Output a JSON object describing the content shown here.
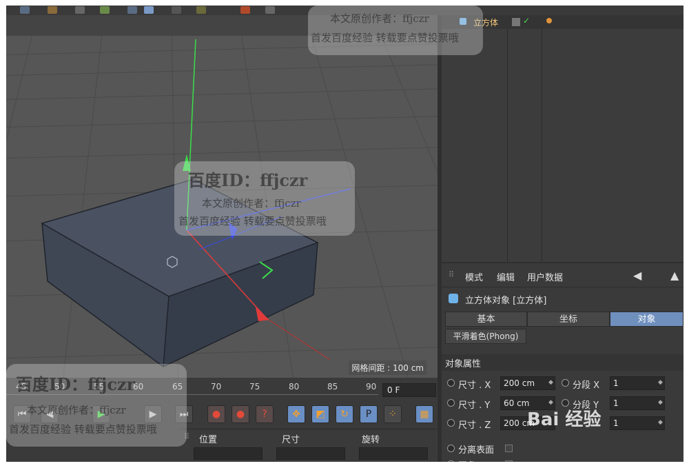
{
  "viewport": {
    "grid_spacing": "网格间距 : 100 cm"
  },
  "object_manager": {
    "object_name": "立方体"
  },
  "attributes": {
    "menu": [
      "模式",
      "编辑",
      "用户数据"
    ],
    "object_title": "立方体对象 [立方体]",
    "tabs": [
      "基本",
      "坐标",
      "对象"
    ],
    "active_tab": "对象",
    "phong_tab": "平滑着色(Phong)",
    "section_title": "对象属性",
    "size_x_label": "尺寸 . X",
    "size_x_value": "200 cm",
    "size_y_label": "尺寸 . Y",
    "size_y_value": "60 cm",
    "size_z_label": "尺寸 . Z",
    "size_z_value": "200 cm",
    "seg_x_label": "分段 X",
    "seg_x_value": "1",
    "seg_y_label": "分段 Y",
    "seg_y_value": "1",
    "seg_z_value": "1",
    "separate_surfaces": "分离表面",
    "fillet": "圆角"
  },
  "timeline": {
    "ticks": [
      "45",
      "50",
      "55",
      "60",
      "65",
      "70",
      "75",
      "80",
      "85",
      "90"
    ],
    "current_frame": "0 F"
  },
  "coordinates": {
    "position": "位置",
    "size": "尺寸",
    "rotation": "旋转"
  },
  "watermarks": {
    "id_line": "百度ID：ffjczr",
    "author_line": "本文原创作者：ffjczr",
    "source_line": "首发百度经验 转载要点赞投票哦",
    "top_author": "本文原创作者：ffjczr",
    "top_source": "首发百度经验 转载要点赞投票哦",
    "logo": "Bai 经验"
  },
  "colors": {
    "accent_tab": "#6f8fbd",
    "object_name": "#f5c77a",
    "axis_y": "#3adf4a",
    "axis_x": "#e23a3a",
    "axis_z": "#3a4ae2"
  }
}
